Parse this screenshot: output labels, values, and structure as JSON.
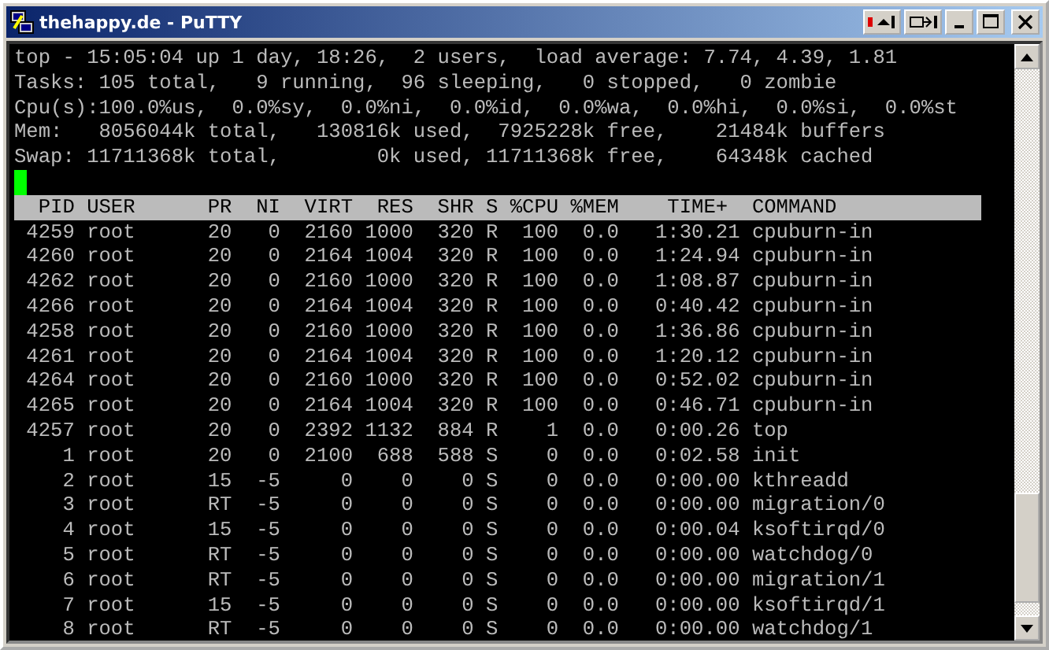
{
  "window": {
    "title": "thehappy.de - PuTTY"
  },
  "terminal": {
    "summary_lines": [
      "top - 15:05:04 up 1 day, 18:26,  2 users,  load average: 7.74, 4.39, 1.81",
      "Tasks: 105 total,   9 running,  96 sleeping,   0 stopped,   0 zombie",
      "Cpu(s):100.0%us,  0.0%sy,  0.0%ni,  0.0%id,  0.0%wa,  0.0%hi,  0.0%si,  0.0%st",
      "Mem:   8056044k total,   130816k used,  7925228k free,    21484k buffers",
      "Swap: 11711368k total,        0k used, 11711368k free,    64348k cached"
    ],
    "cursor_visible": true,
    "table": {
      "header": "  PID USER      PR  NI  VIRT  RES  SHR S %CPU %MEM    TIME+  COMMAND",
      "rows": [
        " 4259 root      20   0  2160 1000  320 R  100  0.0   1:30.21 cpuburn-in",
        " 4260 root      20   0  2164 1004  320 R  100  0.0   1:24.94 cpuburn-in",
        " 4262 root      20   0  2160 1000  320 R  100  0.0   1:08.87 cpuburn-in",
        " 4266 root      20   0  2164 1004  320 R  100  0.0   0:40.42 cpuburn-in",
        " 4258 root      20   0  2160 1000  320 R  100  0.0   1:36.86 cpuburn-in",
        " 4261 root      20   0  2164 1004  320 R  100  0.0   1:20.12 cpuburn-in",
        " 4264 root      20   0  2160 1000  320 R  100  0.0   0:52.02 cpuburn-in",
        " 4265 root      20   0  2164 1004  320 R  100  0.0   0:46.71 cpuburn-in",
        " 4257 root      20   0  2392 1132  884 R    1  0.0   0:00.26 top",
        "    1 root      20   0  2100  688  588 S    0  0.0   0:02.58 init",
        "    2 root      15  -5     0    0    0 S    0  0.0   0:00.00 kthreadd",
        "    3 root      RT  -5     0    0    0 S    0  0.0   0:00.00 migration/0",
        "    4 root      15  -5     0    0    0 S    0  0.0   0:00.04 ksoftirqd/0",
        "    5 root      RT  -5     0    0    0 S    0  0.0   0:00.00 watchdog/0",
        "    6 root      RT  -5     0    0    0 S    0  0.0   0:00.00 migration/1",
        "    7 root      15  -5     0    0    0 S    0  0.0   0:00.00 ksoftirqd/1",
        "    8 root      RT  -5     0    0    0 S    0  0.0   0:00.00 watchdog/1"
      ]
    }
  }
}
